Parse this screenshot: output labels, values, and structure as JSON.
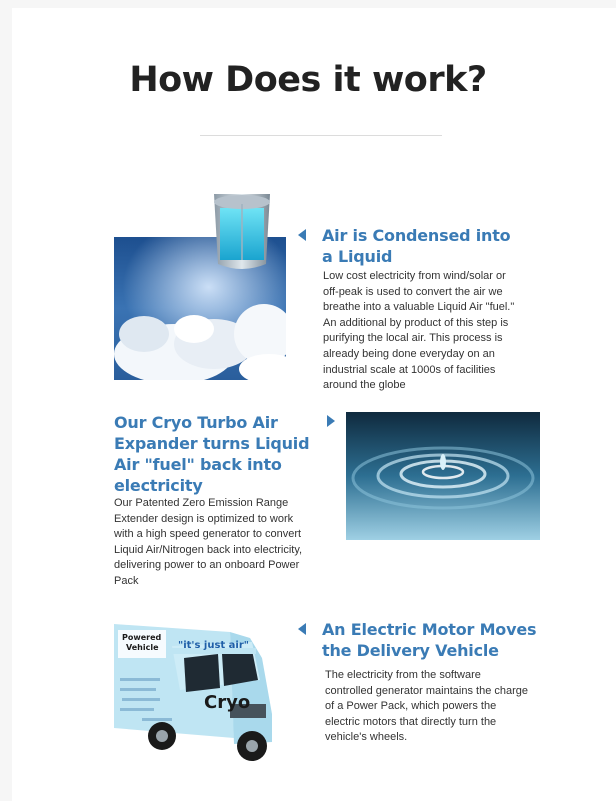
{
  "page": {
    "title": "How Does it work?",
    "steps": [
      {
        "heading": "Air is Condensed into a Liquid",
        "body": "Low cost electricity from wind/solar or off-peak is used to convert the air we breathe into a valuable Liquid Air \"fuel.\" An additional by product of this step is purifying the local air. This process is already being done everyday on an industrial scale at 1000s of facilities around the globe",
        "arrow": "left-arrow-icon"
      },
      {
        "heading": "Our Cryo Turbo Air Expander turns Liquid Air \"fuel\" back into electricity",
        "body": "Our Patented Zero Emission Range Extender design is optimized to work with a high speed generator to convert Liquid Air/Nitrogen back into electricity, delivering power to an onboard Power Pack",
        "arrow": "right-arrow-icon"
      },
      {
        "heading": "An Electric Motor Moves the Delivery Vehicle",
        "body": "The electricity from the software controlled generator maintains the charge of a Power Pack, which powers the electric motors that directly turn the vehicle's wheels.",
        "arrow": "left-arrow-icon"
      }
    ],
    "truck": {
      "badge_line1": "Powered",
      "badge_line2": "Vehicle",
      "slogan": "\"it's just air\"",
      "brand": "Cryo"
    }
  },
  "colors": {
    "accent": "#3a7bb5",
    "title": "#222222",
    "body": "#333333"
  }
}
